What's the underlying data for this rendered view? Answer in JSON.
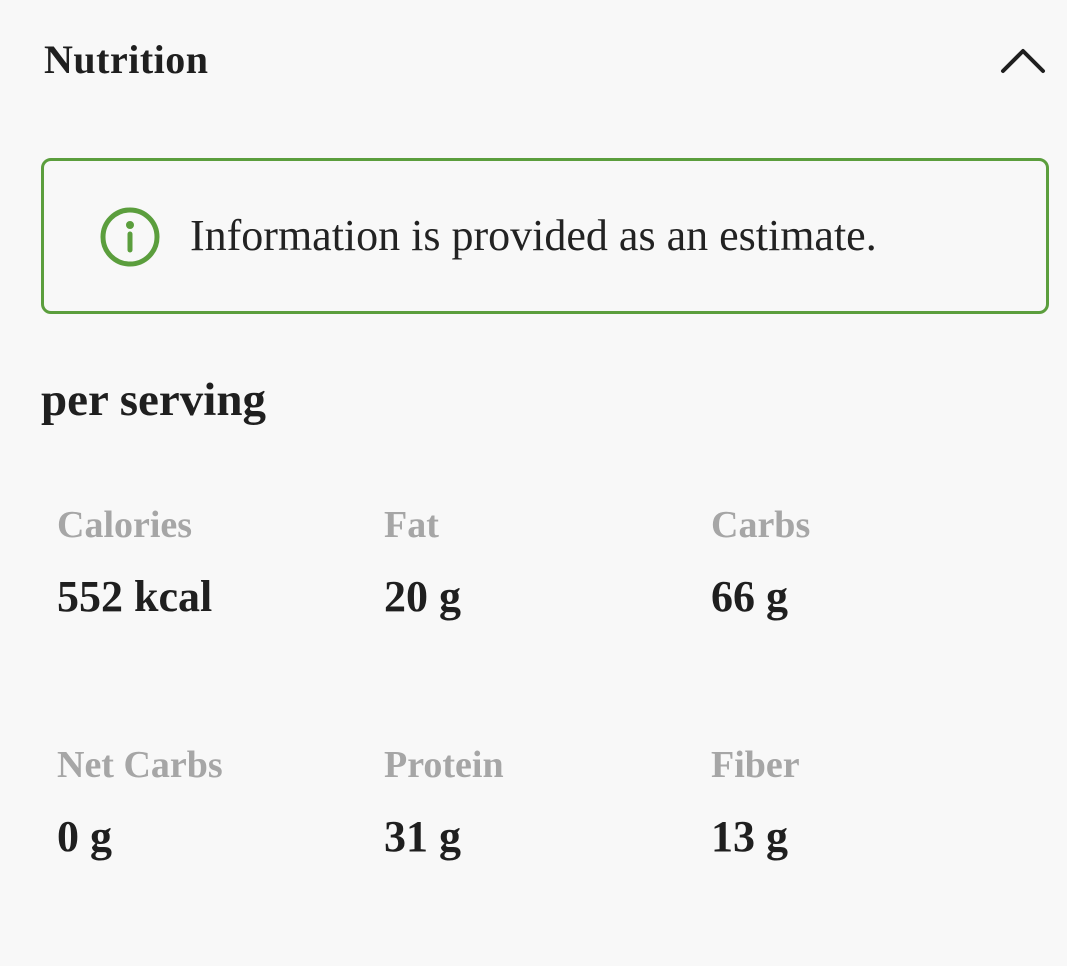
{
  "nutrition": {
    "section_title": "Nutrition",
    "collapse_icon": "chevron-up-icon",
    "notice": {
      "icon": "info-icon",
      "text": "Information is provided as an estimate.",
      "accent_color": "#5b9e3d"
    },
    "per_serving_label": "per serving",
    "items": [
      {
        "label": "Calories",
        "value": "552 kcal"
      },
      {
        "label": "Fat",
        "value": "20 g"
      },
      {
        "label": "Carbs",
        "value": "66 g"
      },
      {
        "label": "Net Carbs",
        "value": "0 g"
      },
      {
        "label": "Protein",
        "value": "31 g"
      },
      {
        "label": "Fiber",
        "value": "13 g"
      }
    ]
  }
}
